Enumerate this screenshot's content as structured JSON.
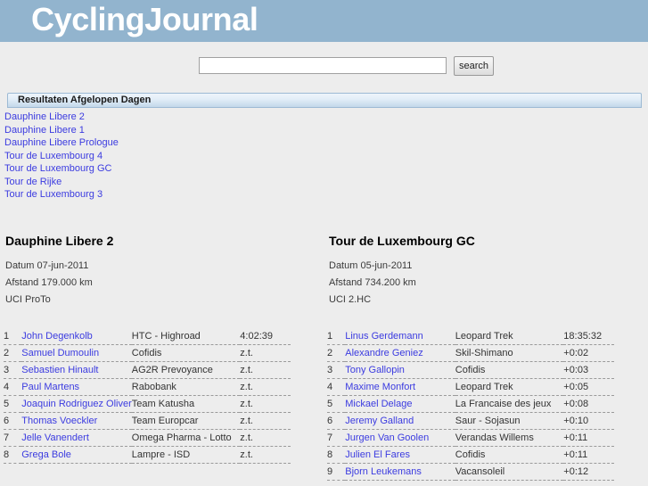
{
  "site": {
    "brand": "CyclingJournal",
    "colors": {
      "masthead_blue": "#92b4ce",
      "page_background": "#ededed",
      "link_blue": "#3b3be0",
      "bar_border": "#9dbad4"
    }
  },
  "search": {
    "value": "",
    "placeholder": "",
    "button_label": "search"
  },
  "recent_section": {
    "title": "Resultaten Afgelopen Dagen",
    "links": [
      "Dauphine Libere 2",
      "Dauphine Libere 1",
      "Dauphine Libere Prologue",
      "Tour de Luxembourg 4",
      "Tour de Luxembourg GC",
      "Tour de Rijke",
      "Tour de Luxembourg 3"
    ]
  },
  "results": [
    {
      "title": "Dauphine Libere 2",
      "date_line": "Datum 07-jun-2011",
      "distance_line": "Afstand 179.000 km",
      "class_line": "UCI ProTo",
      "rows": [
        {
          "rank": "1",
          "rider": "John Degenkolb",
          "team": "HTC - Highroad",
          "time": "4:02:39"
        },
        {
          "rank": "2",
          "rider": "Samuel Dumoulin",
          "team": "Cofidis",
          "time": "z.t."
        },
        {
          "rank": "3",
          "rider": "Sebastien Hinault",
          "team": "AG2R Prevoyance",
          "time": "z.t."
        },
        {
          "rank": "4",
          "rider": "Paul Martens",
          "team": "Rabobank",
          "time": "z.t."
        },
        {
          "rank": "5",
          "rider": "Joaquin Rodriguez Oliver",
          "team": "Team Katusha",
          "time": "z.t."
        },
        {
          "rank": "6",
          "rider": "Thomas Voeckler",
          "team": "Team Europcar",
          "time": "z.t."
        },
        {
          "rank": "7",
          "rider": "Jelle Vanendert",
          "team": "Omega Pharma - Lotto",
          "time": "z.t."
        },
        {
          "rank": "8",
          "rider": "Grega Bole",
          "team": "Lampre - ISD",
          "time": "z.t."
        }
      ]
    },
    {
      "title": "Tour de Luxembourg GC",
      "date_line": "Datum 05-jun-2011",
      "distance_line": "Afstand 734.200 km",
      "class_line": "UCI 2.HC",
      "rows": [
        {
          "rank": "1",
          "rider": "Linus Gerdemann",
          "team": "Leopard Trek",
          "time": "18:35:32"
        },
        {
          "rank": "2",
          "rider": "Alexandre Geniez",
          "team": "Skil-Shimano",
          "time": "+0:02"
        },
        {
          "rank": "3",
          "rider": "Tony Gallopin",
          "team": "Cofidis",
          "time": "+0:03"
        },
        {
          "rank": "4",
          "rider": "Maxime Monfort",
          "team": "Leopard Trek",
          "time": "+0:05"
        },
        {
          "rank": "5",
          "rider": "Mickael Delage",
          "team": "La Francaise des jeux",
          "time": "+0:08"
        },
        {
          "rank": "6",
          "rider": "Jeremy Galland",
          "team": "Saur - Sojasun",
          "time": "+0:10"
        },
        {
          "rank": "7",
          "rider": "Jurgen Van Goolen",
          "team": "Verandas Willems",
          "time": "+0:11"
        },
        {
          "rank": "8",
          "rider": "Julien El Fares",
          "team": "Cofidis",
          "time": "+0:11"
        },
        {
          "rank": "9",
          "rider": "Bjorn Leukemans",
          "team": "Vacansoleil",
          "time": "+0:12"
        }
      ]
    }
  ]
}
